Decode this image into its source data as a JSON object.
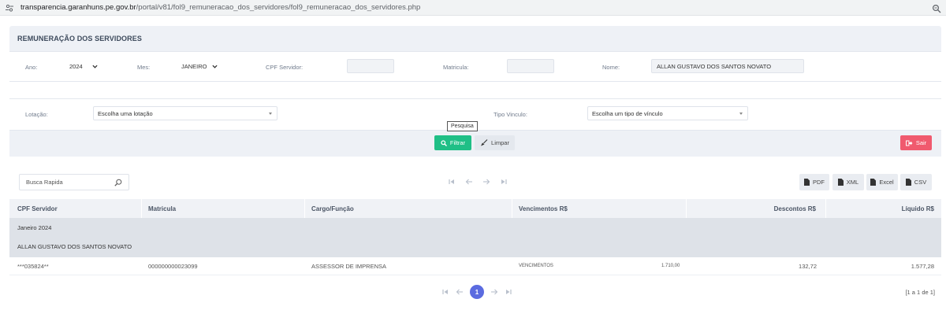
{
  "browser": {
    "url_host": "transparencia.garanhuns.pe.gov.br",
    "url_path": "/portal/v81/fol9_remuneracao_dos_servidores/fol9_remuneracao_dos_servidores.php"
  },
  "panel": {
    "title": "REMUNERAÇÃO DOS SERVIDORES"
  },
  "filters": {
    "ano_label": "Ano:",
    "ano_value": "2024",
    "mes_label": "Mes:",
    "mes_value": "JANEIRO",
    "cpf_label": "CPF Servidor:",
    "cpf_value": "",
    "matricula_label": "Matricula:",
    "matricula_value": "",
    "nome_label": "Nome:",
    "nome_value": "ALLAN GUSTAVO DOS SANTOS NOVATO",
    "lotacao_label": "Lotação:",
    "lotacao_value": "Escolha uma lotação",
    "vinculo_label": "Tipo Vinculo:",
    "vinculo_value": "Escolha um tipo de vínculo"
  },
  "actions": {
    "filtrar_label": "Filtrar",
    "limpar_label": "Limpar",
    "sair_label": "Sair",
    "tooltip": "Pesquisa"
  },
  "toolbar": {
    "search_placeholder": "Busca Rapida",
    "pdf": "PDF",
    "xml": "XML",
    "excel": "Excel",
    "csv": "CSV"
  },
  "table": {
    "columns": [
      "CPF Servidor",
      "Matricula",
      "Cargo/Função",
      "Vencimentos R$",
      "Descontos R$",
      "Líquido R$"
    ],
    "group_period": "Janeiro  2024",
    "group_name": "ALLAN GUSTAVO DOS SANTOS NOVATO",
    "rows": [
      {
        "cpf": "***035824**",
        "matricula": "000000000023099",
        "cargo": "ASSESSOR DE IMPRENSA",
        "venc_label": "VENCIMENTOS",
        "venc_value": "1.710,00",
        "descontos": "132,72",
        "liquido": "1.577,28"
      }
    ]
  },
  "pager": {
    "current": "1",
    "info": "[1 a 1 de 1]"
  },
  "colors": {
    "accent_green": "#1fbf86",
    "danger": "#f05a6e",
    "pager_active": "#5b6be0"
  }
}
